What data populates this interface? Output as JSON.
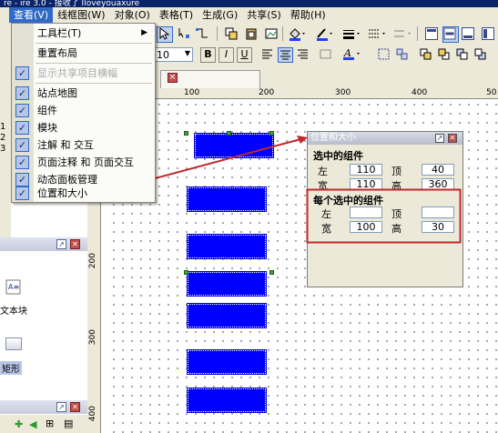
{
  "window": {
    "title": "re - ire 3.0 - 接收了 Iloveyouaxure"
  },
  "menubar": {
    "items": [
      "查看(V)",
      "线框图(W)",
      "对象(O)",
      "表格(T)",
      "生成(G)",
      "共享(S)",
      "帮助(H)"
    ],
    "active_index": 0
  },
  "toolbar2": {
    "font_size": "10"
  },
  "tab": {
    "close": "×"
  },
  "view_menu": {
    "items": [
      {
        "label": "工具栏(T)",
        "checked": false,
        "submenu": true
      },
      {
        "label": "重置布局",
        "checked": false
      },
      {
        "label": "显示共享项目横幅",
        "checked": true,
        "disabled": true
      },
      {
        "label": "站点地图",
        "checked": true
      },
      {
        "label": "组件",
        "checked": true
      },
      {
        "label": "模块",
        "checked": true
      },
      {
        "label": "注解 和 交互",
        "checked": true
      },
      {
        "label": "页面注释 和 页面交互",
        "checked": true
      },
      {
        "label": "动态面板管理",
        "checked": true
      },
      {
        "label": "位置和大小",
        "checked": true
      }
    ]
  },
  "left_panel": {
    "numbers": [
      "1",
      "2",
      "3"
    ],
    "widgets": [
      {
        "label": "文本块",
        "icon": "text-block-icon"
      },
      {
        "label": "矩形",
        "icon": "rectangle-icon"
      }
    ]
  },
  "rulers": {
    "horizontal": [
      "100",
      "200",
      "300",
      "400",
      "50"
    ],
    "vertical": [
      "200",
      "300",
      "400"
    ]
  },
  "position_panel": {
    "title": "位置和大小",
    "selected_heading": "选中的组件",
    "left_label": "左",
    "left_value": "110",
    "top_label": "顶",
    "top_value": "40",
    "width_label": "宽",
    "width_value": "110",
    "height_label": "高",
    "height_value": "360",
    "each_heading": "每个选中的组件",
    "each_left_label": "左",
    "each_left_value": "",
    "each_top_label": "顶",
    "each_top_value": "",
    "each_width_label": "宽",
    "each_width_value": "100",
    "each_height_label": "高",
    "each_height_value": "30"
  },
  "colors": {
    "rect_fill": "#0000ff",
    "menu_highlight": "#316ac5",
    "annotation_red": "#c0282c"
  }
}
